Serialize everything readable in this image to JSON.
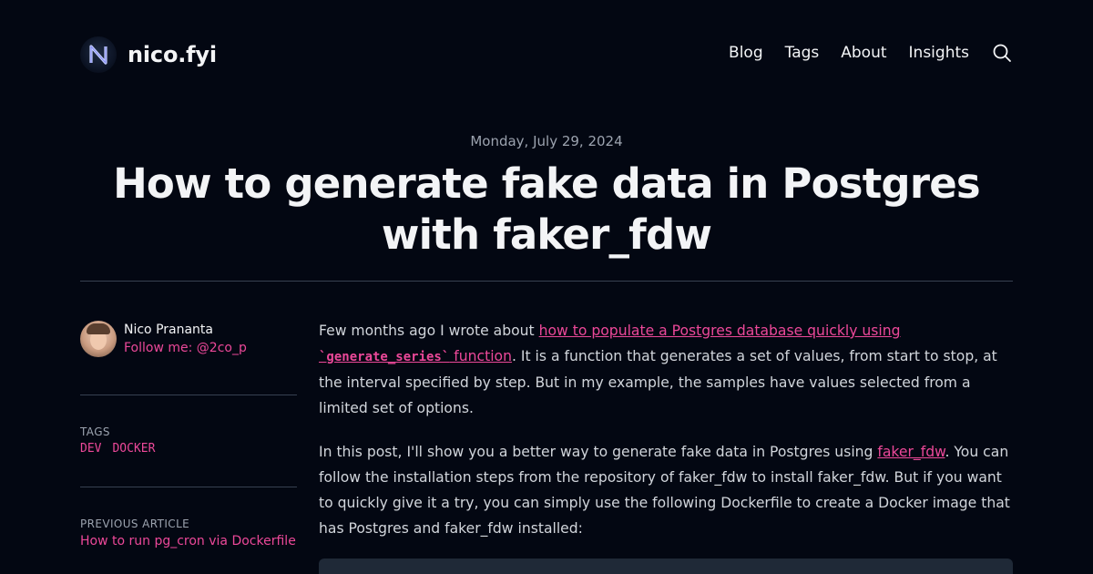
{
  "header": {
    "site_name": "nico.fyi",
    "logo_letter": "N",
    "nav": [
      "Blog",
      "Tags",
      "About",
      "Insights"
    ],
    "search_icon": "search-icon"
  },
  "post": {
    "date": "Monday, July 29, 2024",
    "title": "How to generate fake data in Postgres with faker_fdw"
  },
  "sidebar": {
    "author_name": "Nico Prananta",
    "follow_text": "Follow me: @2co_p",
    "tags_label": "TAGS",
    "tags": [
      "DEV",
      "DOCKER"
    ],
    "prev_label": "PREVIOUS ARTICLE",
    "prev_title": "How to run pg_cron via Dockerfile"
  },
  "article": {
    "p1_before": "Few months ago I wrote about ",
    "p1_link_a": "how to populate a Postgres database quickly using ",
    "p1_link_code": "`generate_series`",
    "p1_link_b": " function",
    "p1_after": ". It is a function that generates a set of values, from start to stop, at the interval specified by step. But in my example, the samples have values selected from a limited set of options.",
    "p2_before": "In this post, I'll show you a better way to generate fake data in Postgres using ",
    "p2_link": "faker_fdw",
    "p2_after": ". You can follow the installation steps from the repository of faker_fdw to install faker_fdw. But if you want to quickly give it a try, you can simply use the following Dockerfile to create a Docker image that has Postgres and faker_fdw installed:"
  },
  "colors": {
    "background": "#030712",
    "accent": "#ec4899",
    "text": "#d1d5db",
    "heading": "#f3f4f6"
  }
}
